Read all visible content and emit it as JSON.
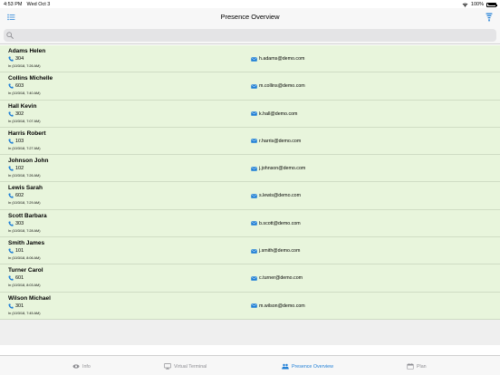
{
  "status_bar": {
    "time": "4:53 PM",
    "date": "Wed Oct 3",
    "battery": "100%"
  },
  "nav": {
    "title": "Presence Overview",
    "left_icon": "menu-list-icon",
    "right_icon": "filter-icon"
  },
  "search": {
    "placeholder": "",
    "icon": "search-icon"
  },
  "colors": {
    "row_background": "#e8f5dc",
    "accent": "#1e7ed6",
    "inactive_tab": "#8e8e93"
  },
  "contacts": [
    {
      "name": "Adams Helen",
      "phone": "304",
      "since": "In (10/3/18, 7:26 AM)",
      "email": "h.adams@demo.com"
    },
    {
      "name": "Collins Michelle",
      "phone": "603",
      "since": "In (10/3/18, 7:40 AM)",
      "email": "m.collins@demo.com"
    },
    {
      "name": "Hall Kevin",
      "phone": "302",
      "since": "In (10/3/18, 7:07 AM)",
      "email": "k.hall@demo.com"
    },
    {
      "name": "Harris Robert",
      "phone": "103",
      "since": "In (10/3/18, 7:27 AM)",
      "email": "r.harris@demo.com"
    },
    {
      "name": "Johnson John",
      "phone": "102",
      "since": "In (10/3/18, 7:26 AM)",
      "email": "j.johnson@demo.com"
    },
    {
      "name": "Lewis Sarah",
      "phone": "602",
      "since": "In (10/3/18, 7:29 AM)",
      "email": "s.lewis@demo.com"
    },
    {
      "name": "Scott Barbara",
      "phone": "303",
      "since": "In (10/3/18, 7:28 AM)",
      "email": "b.scott@demo.com"
    },
    {
      "name": "Smith James",
      "phone": "101",
      "since": "In (10/3/18, 8:06 AM)",
      "email": "j.smith@demo.com"
    },
    {
      "name": "Turner Carol",
      "phone": "601",
      "since": "In (10/3/18, 8:03 AM)",
      "email": "c.turner@demo.com"
    },
    {
      "name": "Wilson Michael",
      "phone": "301",
      "since": "In (10/3/18, 7:45 AM)",
      "email": "m.wilson@demo.com"
    }
  ],
  "tabs": [
    {
      "label": "Info",
      "icon": "eye-icon",
      "active": false
    },
    {
      "label": "Virtual Terminal",
      "icon": "monitor-icon",
      "active": false
    },
    {
      "label": "Presence Overview",
      "icon": "people-icon",
      "active": true
    },
    {
      "label": "Plan",
      "icon": "calendar-icon",
      "active": false
    }
  ]
}
